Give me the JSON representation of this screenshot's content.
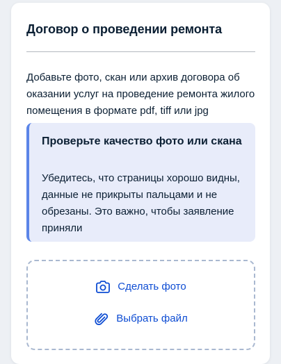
{
  "card": {
    "title": "Договор о проведении ремонта",
    "description": "Добавьте фото, скан или архив договора об оказании услуг на проведение ремонта жилого помещения в формате pdf, tiff или jpg"
  },
  "notice": {
    "title": "Проверьте качество фото или скана",
    "text": "Убедитесь, что страницы хорошо видны, данные не прикрыты пальцами и не обрезаны. Это важно, чтобы заявление приняли",
    "accent_color": "#5b85e8",
    "background_color": "#e8ecfa"
  },
  "upload": {
    "take_photo_label": "Сделать фото",
    "take_photo_icon": "camera-icon",
    "choose_file_label": "Выбрать файл",
    "choose_file_icon": "paperclip-icon",
    "link_color": "#0d4cd3"
  }
}
